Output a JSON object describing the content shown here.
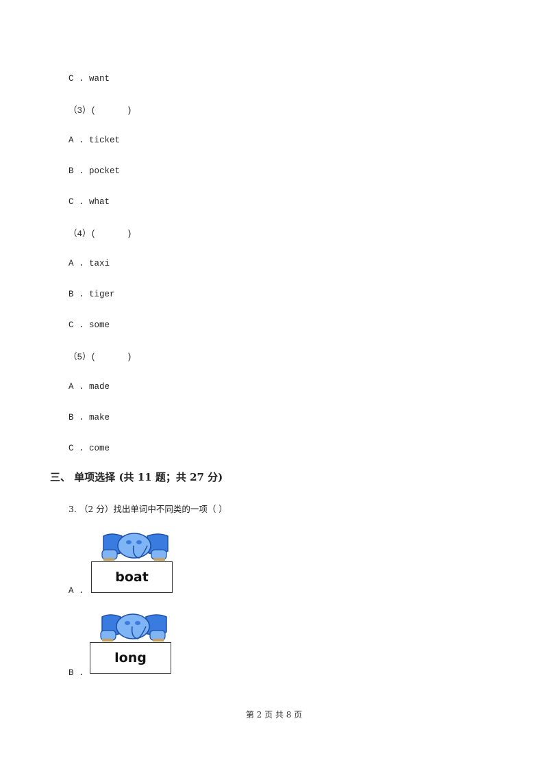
{
  "questions": [
    {
      "label": "C . want"
    },
    {
      "label": "（3）(      )"
    },
    {
      "label": "A . ticket"
    },
    {
      "label": "B . pocket"
    },
    {
      "label": "C . what"
    },
    {
      "label": "（4）(      )"
    },
    {
      "label": "A . taxi"
    },
    {
      "label": "B . tiger"
    },
    {
      "label": "C . some"
    },
    {
      "label": "（5）(      )"
    },
    {
      "label": "A . made"
    },
    {
      "label": "B . make"
    },
    {
      "label": "C . come"
    }
  ],
  "section": {
    "title": "三、  单项选择 (共 11 题；共 27 分)"
  },
  "question3": {
    "text": "3.  （2 分）找出单词中不同类的一项（      ）",
    "options": [
      {
        "letter": "A .",
        "word": "boat",
        "image": "elephant-holding-sign"
      },
      {
        "letter": "B .",
        "word": "long",
        "image": "elephant-holding-sign"
      }
    ]
  },
  "footer": {
    "page": "第 2 页 共 8 页"
  }
}
